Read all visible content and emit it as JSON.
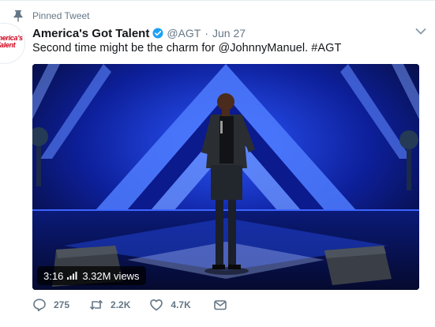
{
  "pinned": {
    "label": "Pinned Tweet"
  },
  "account": {
    "avatar_text_line1": "merica's",
    "avatar_text_line2": "Talent",
    "display_name": "America's Got Talent",
    "handle": "@AGT",
    "separator": "·",
    "time": "Jun 27"
  },
  "tweet": {
    "text": "Second time might be the charm for @JohnnyManuel. #AGT"
  },
  "video": {
    "duration": "3:16",
    "views": "3.32M views"
  },
  "actions": {
    "replies": "275",
    "retweets": "2.2K",
    "likes": "4.7K"
  },
  "colors": {
    "verified": "#1da1f2",
    "muted": "#657786",
    "text": "#14171a",
    "stage_blue": "#1a4bff"
  }
}
